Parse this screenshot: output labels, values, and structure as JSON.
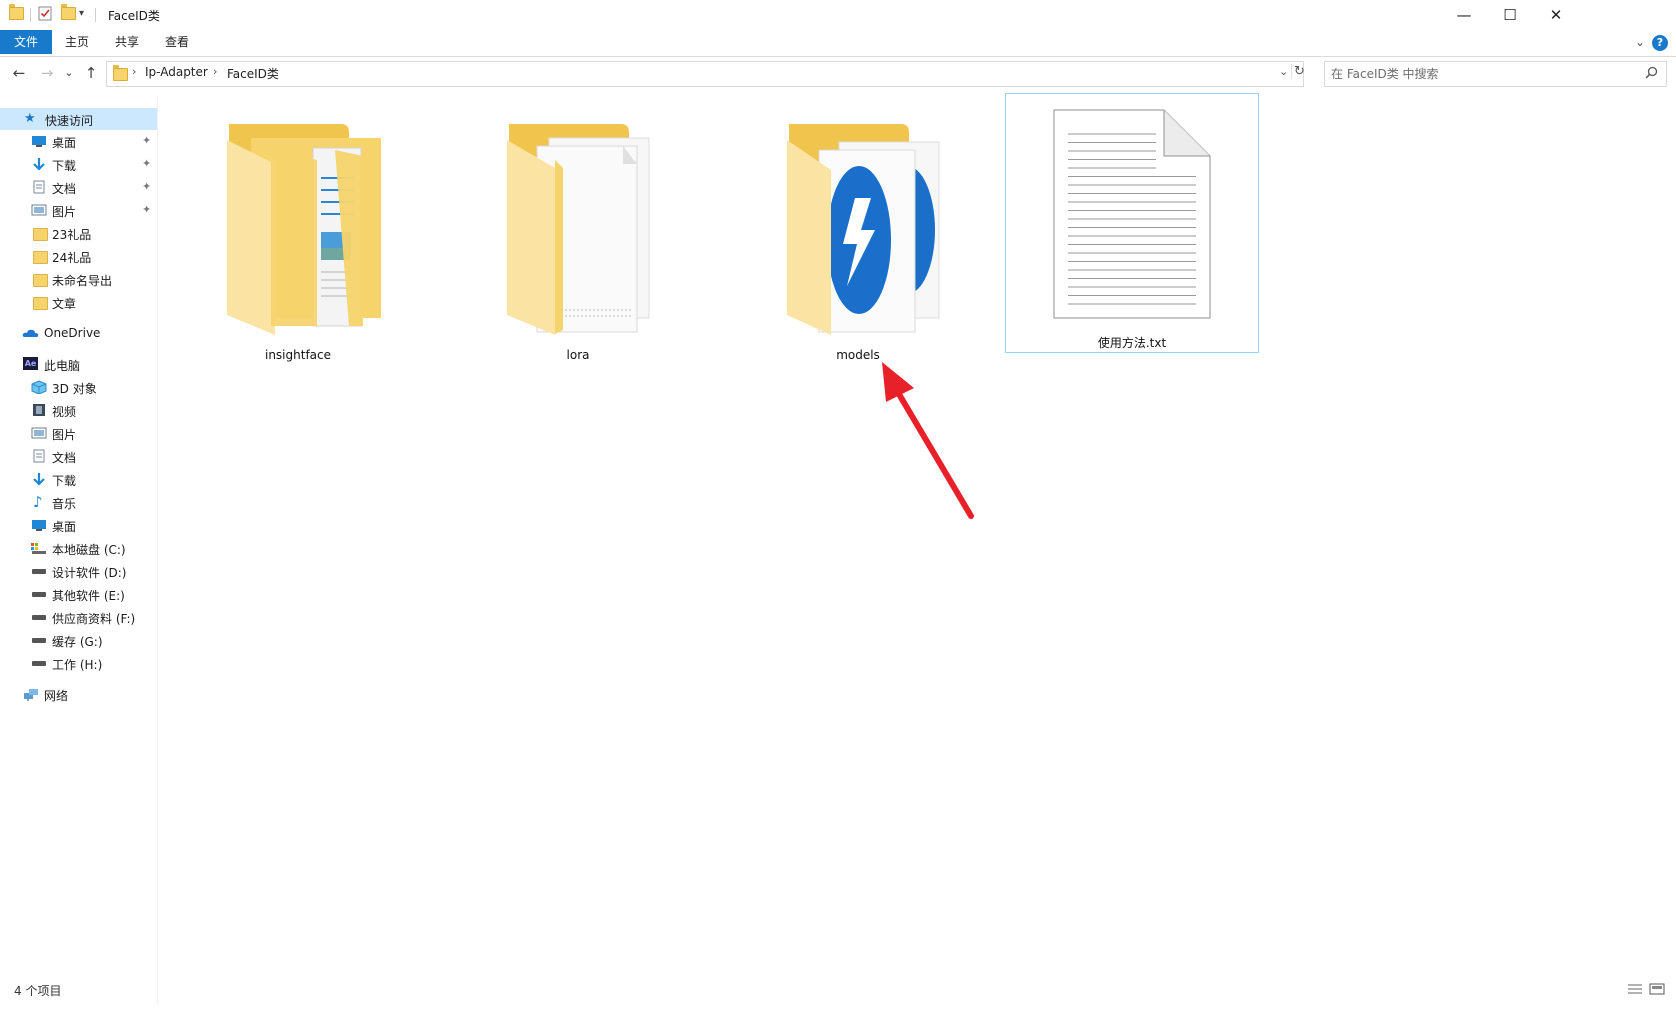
{
  "window": {
    "title": "FaceID类",
    "minimize_glyph": "—",
    "maximize_glyph": "☐",
    "close_glyph": "✕"
  },
  "ribbon": {
    "tabs": [
      "文件",
      "主页",
      "共享",
      "查看"
    ],
    "active_tab": "文件",
    "collapse_glyph": "⌄",
    "help_glyph": "?"
  },
  "address_bar": {
    "back_glyph": "←",
    "forward_glyph": "→",
    "recent_glyph": "⌄",
    "up_glyph": "↑",
    "crumbs": [
      "Ip-Adapter",
      "FaceID类"
    ],
    "separator": "›",
    "dropdown_glyph": "⌄",
    "refresh_glyph": "↻"
  },
  "search": {
    "placeholder": "在 FaceID类 中搜索",
    "icon": "search-icon"
  },
  "nav_pane": {
    "quick_access": {
      "label": "快速访问",
      "items": [
        {
          "label": "桌面",
          "icon": "desktop-icon",
          "pinned": true
        },
        {
          "label": "下载",
          "icon": "download-icon",
          "pinned": true
        },
        {
          "label": "文档",
          "icon": "document-icon",
          "pinned": true
        },
        {
          "label": "图片",
          "icon": "picture-icon",
          "pinned": true
        },
        {
          "label": "23礼品",
          "icon": "folder-icon"
        },
        {
          "label": "24礼品",
          "icon": "folder-icon"
        },
        {
          "label": "未命名导出",
          "icon": "folder-icon"
        },
        {
          "label": "文章",
          "icon": "folder-icon"
        }
      ]
    },
    "onedrive": {
      "label": "OneDrive",
      "icon": "cloud-icon"
    },
    "this_pc": {
      "label": "此电脑",
      "icon_text": "Ae",
      "items": [
        {
          "label": "3D 对象",
          "icon": "3d-objects-icon"
        },
        {
          "label": "视频",
          "icon": "video-icon"
        },
        {
          "label": "图片",
          "icon": "picture-icon"
        },
        {
          "label": "文档",
          "icon": "document-icon"
        },
        {
          "label": "下载",
          "icon": "download-icon"
        },
        {
          "label": "音乐",
          "icon": "music-icon"
        },
        {
          "label": "桌面",
          "icon": "desktop-icon"
        },
        {
          "label": "本地磁盘 (C:)",
          "icon": "system-drive-icon"
        },
        {
          "label": "设计软件 (D:)",
          "icon": "drive-icon"
        },
        {
          "label": "其他软件 (E:)",
          "icon": "drive-icon"
        },
        {
          "label": "供应商资料 (F:)",
          "icon": "drive-icon"
        },
        {
          "label": "缓存 (G:)",
          "icon": "drive-icon"
        },
        {
          "label": "工作 (H:)",
          "icon": "drive-icon"
        }
      ]
    },
    "network": {
      "label": "网络",
      "icon": "network-icon"
    },
    "pin_glyph": "📌"
  },
  "content": {
    "items": [
      {
        "name": "insightface",
        "type": "folder",
        "icon": "folder-with-documents-icon"
      },
      {
        "name": "lora",
        "type": "folder",
        "icon": "folder-with-files-icon"
      },
      {
        "name": "models",
        "type": "folder",
        "icon": "folder-with-app-icon"
      },
      {
        "name": "使用方法.txt",
        "type": "file",
        "icon": "text-file-icon",
        "selected": true
      }
    ]
  },
  "annotation": {
    "type": "red-arrow",
    "points_to": "models",
    "color": "#e8202a"
  },
  "status_bar": {
    "item_count": "4 个项目"
  },
  "colors": {
    "accent": "#1979ca",
    "selection": "#cce8ff",
    "folder": "#f6d36b"
  }
}
